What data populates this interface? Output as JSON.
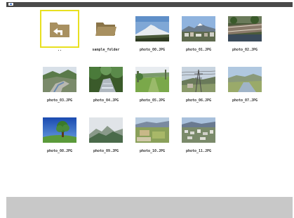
{
  "grid": {
    "items": [
      {
        "label": "..",
        "type": "parent-folder",
        "selected": true
      },
      {
        "label": "sample_folder",
        "type": "folder"
      },
      {
        "label": "photo_00.JPG",
        "type": "photo"
      },
      {
        "label": "photo_01.JPG",
        "type": "photo"
      },
      {
        "label": "photo_02.JPG",
        "type": "photo"
      },
      {
        "label": "photo_03.JPG",
        "type": "photo"
      },
      {
        "label": "photo_04.JPG",
        "type": "photo"
      },
      {
        "label": "photo_05.JPG",
        "type": "photo"
      },
      {
        "label": "photo_06.JPG",
        "type": "photo"
      },
      {
        "label": "photo_07.JPG",
        "type": "photo"
      },
      {
        "label": "photo_08.JPG",
        "type": "photo"
      },
      {
        "label": "photo_09.JPG",
        "type": "photo"
      },
      {
        "label": "photo_10.JPG",
        "type": "photo"
      },
      {
        "label": "photo_11.JPG",
        "type": "photo"
      }
    ]
  },
  "colors": {
    "selection_border": "#e8e020",
    "folder": "#a89060",
    "topbar": "#4a4a4a",
    "bottombar": "#c8c8c8"
  }
}
